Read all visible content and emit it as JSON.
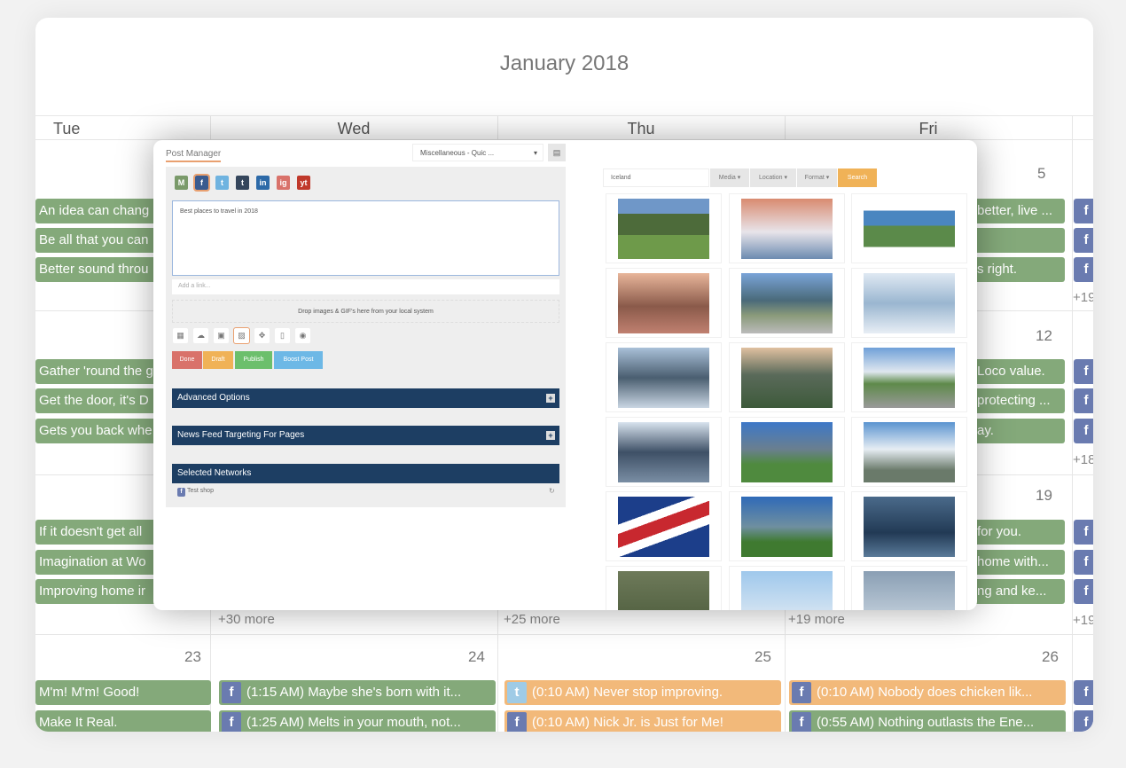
{
  "calendar": {
    "title": "January 2018",
    "weekdays": [
      "Tue",
      "Wed",
      "Thu",
      "Fri"
    ],
    "dates": {
      "r1": "5",
      "r2": "12",
      "r3": "19",
      "r4": [
        "23",
        "24",
        "25",
        "26"
      ]
    },
    "tue_events": [
      "An idea can chang",
      "Be all that you can",
      "Better sound throu",
      "Gather 'round the g",
      "Get the door, it's D",
      "Gets you back whe",
      "If it doesn't get all",
      "Imagination at Wo",
      "Improving home ir",
      "M'm! M'm! Good!",
      "Make It Real."
    ],
    "fri_events": [
      "better, live ...",
      "",
      "s right.",
      "Loco value.",
      "protecting ...",
      "ay.",
      "for you.",
      "home with...",
      "ng and ke..."
    ],
    "more": {
      "wed": "+30 more",
      "thu": "+25 more",
      "fri": "+19 more",
      "sat": [
        "+19",
        "+18",
        "+19"
      ]
    },
    "row4": {
      "wed": [
        "(1:15 AM)  Maybe she's born with it...",
        "(1:25 AM)  Melts in your mouth, not..."
      ],
      "thu": [
        "(0:10 AM)  Never stop improving.",
        "(0:10 AM)  Nick Jr. is Just for Me!"
      ],
      "fri": [
        "(0:10 AM)  Nobody does chicken lik...",
        "(0:55 AM) Nothing outlasts the Ene..."
      ]
    },
    "colors": {
      "green": "#84a97a",
      "orange": "#f2b97a",
      "facebook": "#6a7bb0",
      "navy": "#1d3e63"
    }
  },
  "post_manager": {
    "tab": "Post Manager",
    "category_select": "Miscellaneous - Quic ...",
    "networks": [
      "M",
      "f",
      "t",
      "t",
      "in",
      "ig",
      "yt"
    ],
    "post_text": "Best places to travel in 2018",
    "link_placeholder": "Add a link...",
    "drop_text": "Drop images & GIF's here from your local system",
    "tools": [
      "calendar-icon",
      "cloud-icon",
      "briefcase-icon",
      "image-icon",
      "move-icon",
      "crop-icon",
      "eye-icon"
    ],
    "buttons": {
      "done": "Done",
      "draft": "Draft",
      "publish": "Publish",
      "boost": "Boost Post"
    },
    "sections": {
      "advanced": "Advanced Options",
      "newsfeed": "News Feed Targeting For Pages",
      "selected": "Selected Networks"
    },
    "selected_network": "Test shop"
  },
  "media_search": {
    "query": "Iceland",
    "media": "Media ▾",
    "location": "Location ▾",
    "format": "Format ▾",
    "search": "Search"
  }
}
